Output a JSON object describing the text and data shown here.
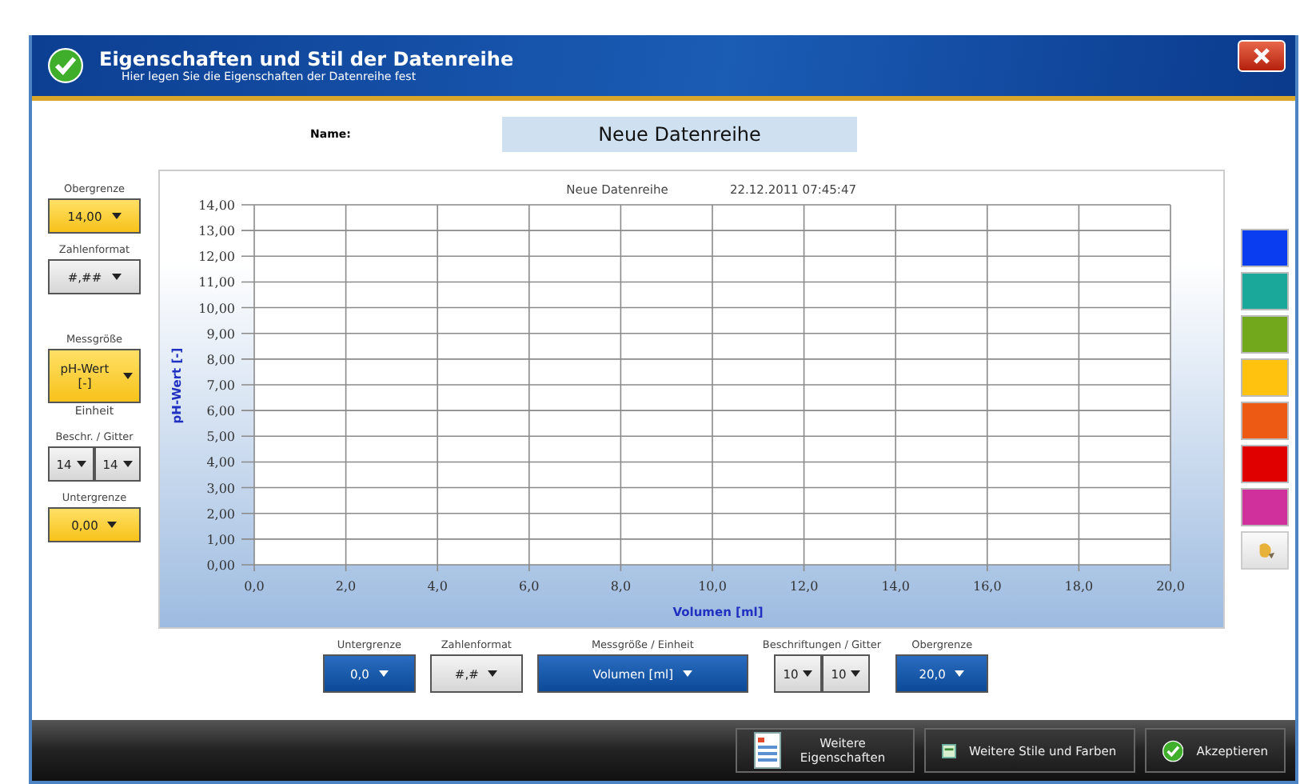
{
  "window": {
    "title": "Eigenschaften und Stil der Datenreihe",
    "subtitle": "Hier legen Sie die Eigenschaften der Datenreihe fest"
  },
  "name": {
    "label": "Name:",
    "value": "Neue Datenreihe"
  },
  "y_axis_controls": [
    {
      "kind": "single",
      "label": "Obergrenze",
      "value": "14,00",
      "accent": true
    },
    {
      "kind": "single",
      "label": "Zahlenformat",
      "value": "#,##",
      "accent": false
    },
    {
      "kind": "single",
      "label": "Messgröße",
      "value": "pH-Wert [-]",
      "accent": true,
      "note": "Einheit"
    },
    {
      "kind": "split",
      "label": "Beschr. / Gitter",
      "values": [
        "14",
        "14"
      ]
    },
    {
      "kind": "single",
      "label": "Untergrenze",
      "value": "0,00",
      "accent": true
    }
  ],
  "chart": {
    "title": "Neue Datenreihe",
    "timestamp": "22.12.2011 07:45:47",
    "chart_data": {
      "type": "line",
      "grid": true,
      "xlabel": "Volumen [ml]",
      "ylabel": "pH-Wert [-]",
      "xlim": [
        0,
        20
      ],
      "ylim": [
        0,
        14
      ],
      "xticks": [
        {
          "value": 0,
          "label": "0,0"
        },
        {
          "value": 2,
          "label": "2,0"
        },
        {
          "value": 4,
          "label": "4,0"
        },
        {
          "value": 6,
          "label": "6,0"
        },
        {
          "value": 8,
          "label": "8,0"
        },
        {
          "value": 10,
          "label": "10,0"
        },
        {
          "value": 12,
          "label": "12,0"
        },
        {
          "value": 14,
          "label": "14,0"
        },
        {
          "value": 16,
          "label": "16,0"
        },
        {
          "value": 18,
          "label": "18,0"
        },
        {
          "value": 20,
          "label": "20,0"
        }
      ],
      "yticks": [
        {
          "value": 0,
          "label": "0,00"
        },
        {
          "value": 1,
          "label": "1,00"
        },
        {
          "value": 2,
          "label": "2,00"
        },
        {
          "value": 3,
          "label": "3,00"
        },
        {
          "value": 4,
          "label": "4,00"
        },
        {
          "value": 5,
          "label": "5,00"
        },
        {
          "value": 6,
          "label": "6,00"
        },
        {
          "value": 7,
          "label": "7,00"
        },
        {
          "value": 8,
          "label": "8,00"
        },
        {
          "value": 9,
          "label": "9,00"
        },
        {
          "value": 10,
          "label": "10,00"
        },
        {
          "value": 11,
          "label": "11,00"
        },
        {
          "value": 12,
          "label": "12,00"
        },
        {
          "value": 13,
          "label": "13,00"
        },
        {
          "value": 14,
          "label": "14,00"
        }
      ]
    }
  },
  "swatches": [
    {
      "color": "#0a3cf0"
    },
    {
      "color": "#1aa89a"
    },
    {
      "color": "#72a81c"
    },
    {
      "color": "#ffc20e"
    },
    {
      "color": "#ec5a14"
    },
    {
      "color": "#e00000"
    },
    {
      "color": "#d0309c"
    }
  ],
  "x_axis_controls": [
    {
      "kind": "single",
      "label": "Untergrenze",
      "value": "0,0",
      "accent": true
    },
    {
      "kind": "single",
      "label": "Zahlenformat",
      "value": "#,#",
      "accent": false
    },
    {
      "kind": "wide",
      "label": "Messgröße / Einheit",
      "value": "Volumen [ml]",
      "accent": true
    },
    {
      "kind": "split",
      "label": "Beschriftungen / Gitter",
      "values": [
        "10",
        "10"
      ]
    },
    {
      "kind": "single",
      "label": "Obergrenze",
      "value": "20,0",
      "accent": true
    }
  ],
  "footer_buttons": [
    {
      "kind": "properties",
      "label": "Weitere Eigenschaften"
    },
    {
      "kind": "styles",
      "label": "Weitere Stile und Farben"
    },
    {
      "kind": "accept",
      "label": "Akzeptieren"
    }
  ]
}
